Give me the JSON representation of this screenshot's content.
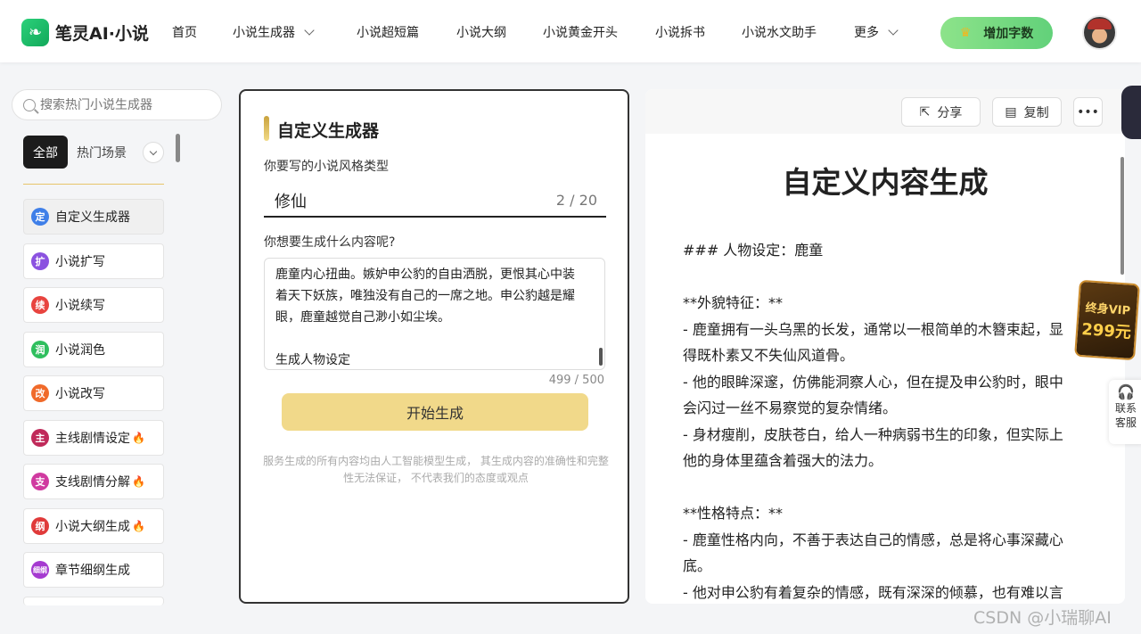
{
  "header": {
    "logo_text": "笔灵AI·小说",
    "nav": [
      {
        "label": "首页"
      },
      {
        "label": "小说生成器"
      },
      {
        "label": "小说超短篇"
      },
      {
        "label": "小说大纲"
      },
      {
        "label": "小说黄金开头"
      },
      {
        "label": "小说拆书"
      },
      {
        "label": "小说水文助手"
      },
      {
        "label": "更多"
      }
    ],
    "add_words_label": "增加字数"
  },
  "sidebar": {
    "search_placeholder": "搜索热门小说生成器",
    "tabs": {
      "all": "全部",
      "hot": "热门场景"
    },
    "items": [
      {
        "label": "自定义生成器",
        "icon": "定",
        "color": "#3f7fe8"
      },
      {
        "label": "小说扩写",
        "icon": "扩",
        "color": "#8b52e0"
      },
      {
        "label": "小说续写",
        "icon": "续",
        "color": "#e8443f"
      },
      {
        "label": "小说润色",
        "icon": "润",
        "color": "#2fbf5e"
      },
      {
        "label": "小说改写",
        "icon": "改",
        "color": "#f06a2a"
      },
      {
        "label": "主线剧情设定",
        "icon": "主",
        "color": "#c02a5a"
      },
      {
        "label": "支线剧情分解",
        "icon": "支",
        "color": "#d03aa0"
      },
      {
        "label": "小说大纲生成",
        "icon": "纲",
        "color": "#e03a3a"
      },
      {
        "label": "章节细纲生成",
        "icon": "细纲",
        "color": "#a53ad0"
      }
    ]
  },
  "form": {
    "title": "自定义生成器",
    "style_label": "你要写的小说风格类型",
    "style_value": "修仙",
    "style_count": "2 / 20",
    "content_label": "你想要生成什么内容呢?",
    "content_lines": [
      "鹿童内心扭曲。嫉妒申公豹的自由洒脱，更恨其心中装",
      "着天下妖族，唯独没有自己的一席之地。申公豹越是耀",
      "眼，鹿童越觉自己渺小如尘埃。",
      "",
      "生成人物设定"
    ],
    "content_count": "499 / 500",
    "generate_label": "开始生成",
    "disclaimer": "服务生成的所有内容均由人工智能模型生成， 其生成内容的准确性和完整性无法保证， 不代表我们的态度或观点"
  },
  "output": {
    "share_label": "分享",
    "copy_label": "复制",
    "more_label": "•••",
    "title": "自定义内容生成",
    "lines": [
      "### 人物设定：鹿童",
      "",
      "**外貌特征：**",
      "- 鹿童拥有一头乌黑的长发，通常以一根简单的木簪束起，显",
      "得既朴素又不失仙风道骨。",
      "- 他的眼眸深邃，仿佛能洞察人心，但在提及申公豹时，眼中",
      "会闪过一丝不易察觉的复杂情绪。",
      "- 身材瘦削，皮肤苍白，给人一种病弱书生的印象，但实际上",
      "他的身体里蕴含着强大的法力。",
      "",
      "**性格特点：**",
      "- 鹿童性格内向，不善于表达自己的情感，总是将心事深藏心",
      "底。",
      "- 他对申公豹有着复杂的情感，既有深深的倾慕，也有难以言"
    ]
  },
  "floating": {
    "vip_line1": "终身VIP",
    "vip_line2": "299元",
    "contact_line1": "联系",
    "contact_line2": "客服"
  },
  "watermark": "CSDN @小瑞聊AI"
}
